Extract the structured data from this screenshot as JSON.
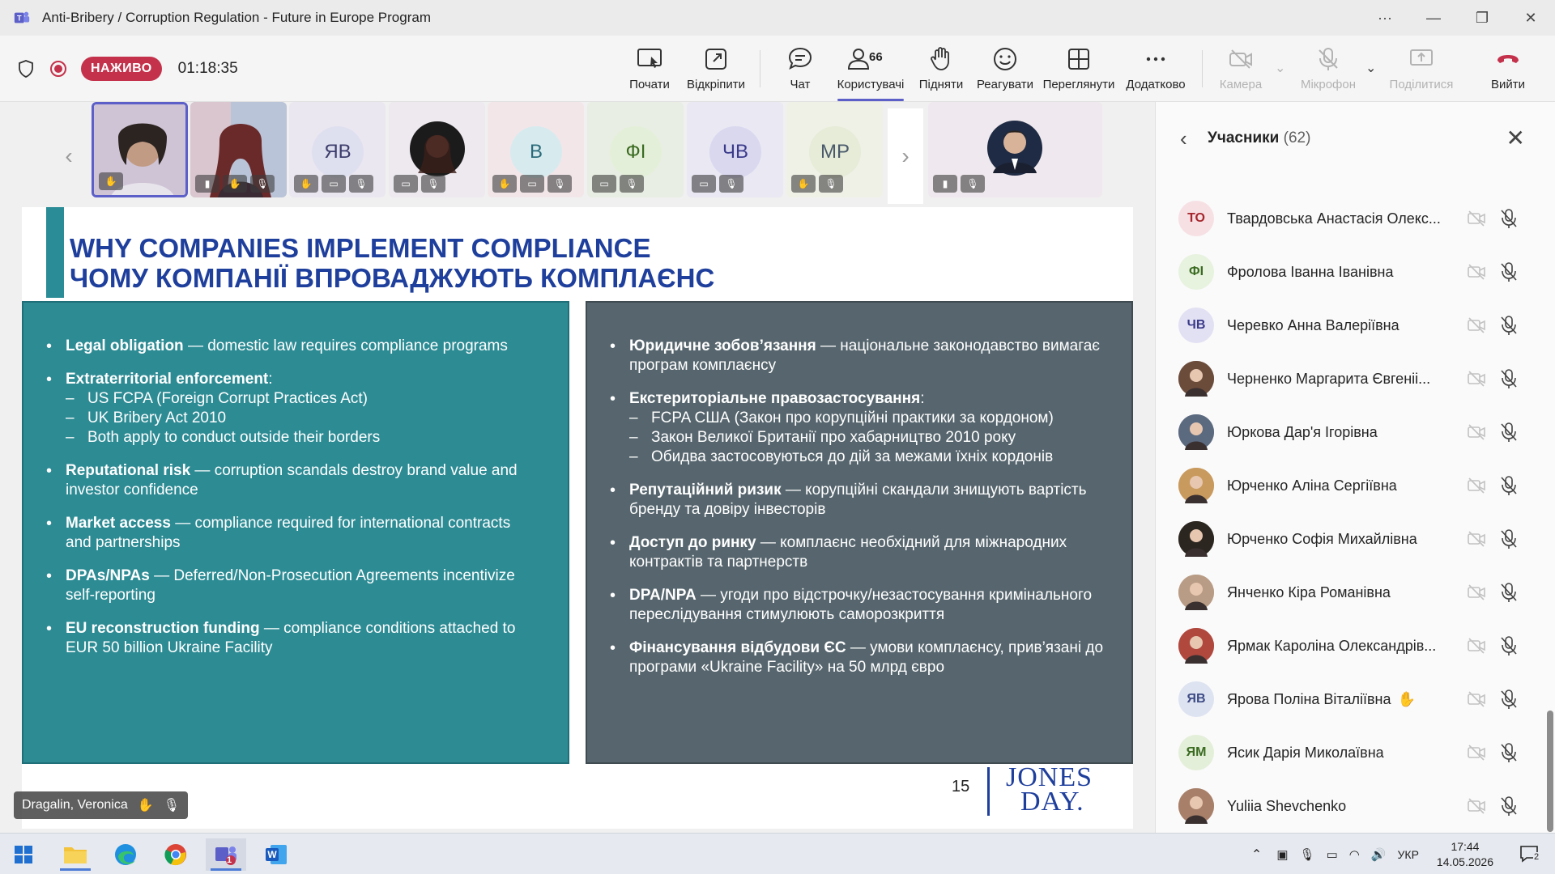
{
  "window": {
    "title": "Anti-Bribery / Corruption Regulation - Future in Europe Program"
  },
  "toolbar": {
    "live_label": "НАЖИВО",
    "timer": "01:18:35",
    "buttons": [
      {
        "label": "Почати"
      },
      {
        "label": "Відкріпити"
      },
      {
        "label": "Чат"
      },
      {
        "label": "Користувачі",
        "count": "66"
      },
      {
        "label": "Підняти"
      },
      {
        "label": "Реагувати"
      },
      {
        "label": "Переглянути"
      },
      {
        "label": "Додатково"
      },
      {
        "label": "Камера"
      },
      {
        "label": "Мікрофон"
      },
      {
        "label": "Поділитися"
      },
      {
        "label": "Вийти"
      }
    ]
  },
  "thumbnails": [
    {
      "initials": "",
      "color": "#d9cfe0"
    },
    {
      "initials": "",
      "color": "#b8c6d8"
    },
    {
      "initials": "ЯВ",
      "color": "#dfe0ef"
    },
    {
      "initials": "",
      "color": "#1b1b1b"
    },
    {
      "initials": "В",
      "color": "#d7ebef"
    },
    {
      "initials": "ФІ",
      "color": "#e4efd9"
    },
    {
      "initials": "ЧВ",
      "color": "#d9d8ef"
    },
    {
      "initials": "МР",
      "color": "#e6ecd8"
    },
    {
      "initials": "",
      "color": "#1f2b44"
    }
  ],
  "slide": {
    "title_en": "WHY COMPANIES IMPLEMENT COMPLIANCE",
    "title_ua": "ЧОМУ КОМПАНІЇ ВПРОВАДЖУЮТЬ КОМПЛАЄНС",
    "left": [
      {
        "bold": "Legal obligation",
        "text": " — domestic law requires compliance programs",
        "subs": []
      },
      {
        "bold": "Extraterritorial enforcement",
        "text": ":",
        "subs": [
          "US FCPA (Foreign Corrupt Practices Act)",
          "UK Bribery Act 2010",
          "Both apply to conduct outside their borders"
        ]
      },
      {
        "bold": "Reputational risk",
        "text": " — corruption scandals destroy brand value and investor confidence",
        "subs": []
      },
      {
        "bold": "Market access",
        "text": " — compliance required for international contracts and partnerships",
        "subs": []
      },
      {
        "bold": "DPAs/NPAs",
        "text": " — Deferred/Non-Prosecution Agreements incentivize self-reporting",
        "subs": []
      },
      {
        "bold": "EU reconstruction funding",
        "text": " — compliance conditions attached to EUR 50 billion Ukraine Facility",
        "subs": []
      }
    ],
    "right": [
      {
        "bold": "Юридичне зобов’язання",
        "text": " — національне законодавство вимагає програм комплаєнсу",
        "subs": []
      },
      {
        "bold": "Екстериторіальне правозастосування",
        "text": ":",
        "subs": [
          "FCPA США (Закон про корупційні практики за кордоном)",
          "Закон Великої Британії про хабарництво 2010 року",
          "Обидва застосовуються до дій за межами їхніх кордонів"
        ]
      },
      {
        "bold": "Репутаційний ризик",
        "text": " — корупційні скандали знищують вартість бренду та довіру інвесторів",
        "subs": []
      },
      {
        "bold": "Доступ до ринку",
        "text": " — комплаєнс необхідний для міжнародних контрактів та партнерств",
        "subs": []
      },
      {
        "bold": "DPA/NPA",
        "text": " — угоди про відстрочку/незастосування кримінального переслідування стимулюють саморозкриття",
        "subs": []
      },
      {
        "bold": "Фінансування відбудови ЄС",
        "text": " — умови комплаєнсу, прив’язані до програми «Ukraine Facility» на 50 млрд євро",
        "subs": []
      }
    ],
    "page_number": "15",
    "logo_line1": "JONES",
    "logo_line2": "DAY."
  },
  "speaker": {
    "name": "Dragalin, Veronica"
  },
  "participants_panel": {
    "title": "Учасники",
    "count": "(62)",
    "rows": [
      {
        "initials": "ТО",
        "name": "Твардовська Анастасія Олекс...",
        "bg": "#f6e0e4",
        "fg": "#a4262c",
        "photo": false
      },
      {
        "initials": "ФІ",
        "name": "Фролова Іванна Іванівна",
        "bg": "#e7f2df",
        "fg": "#3a6b21",
        "photo": false
      },
      {
        "initials": "ЧВ",
        "name": "Черевко Анна Валеріївна",
        "bg": "#e2e1f3",
        "fg": "#3b3a8a",
        "photo": false
      },
      {
        "initials": "",
        "name": "Черненко Маргарита Євгеніі...",
        "bg": "#6b4c3b",
        "fg": "#fff",
        "photo": true
      },
      {
        "initials": "",
        "name": "Юркова Дар'я Ігорівна",
        "bg": "#5c6a80",
        "fg": "#fff",
        "photo": true
      },
      {
        "initials": "",
        "name": "Юрченко Аліна Сергіївна",
        "bg": "#c99a5e",
        "fg": "#fff",
        "photo": true
      },
      {
        "initials": "",
        "name": "Юрченко Софія Михайлівна",
        "bg": "#2c2620",
        "fg": "#fff",
        "photo": true
      },
      {
        "initials": "",
        "name": "Янченко Кіра Романівна",
        "bg": "#b99c85",
        "fg": "#fff",
        "photo": true
      },
      {
        "initials": "",
        "name": "Ярмак Кароліна Олександрів...",
        "bg": "#b0483e",
        "fg": "#fff",
        "photo": true
      },
      {
        "initials": "ЯВ",
        "name": "Ярова Поліна Віталіївна",
        "bg": "#dde3f0",
        "fg": "#3e4b86",
        "photo": false,
        "hand": true
      },
      {
        "initials": "ЯМ",
        "name": "Ясик Дарія Миколаївна",
        "bg": "#e4efda",
        "fg": "#3a6b21",
        "photo": false
      },
      {
        "initials": "",
        "name": "Yuliia Shevchenko",
        "bg": "#a8806a",
        "fg": "#fff",
        "photo": true
      }
    ]
  },
  "taskbar": {
    "language": "УКР",
    "time": "17:44",
    "date": "14.05.2026",
    "notification_count": "2",
    "teams_badge": "1"
  }
}
